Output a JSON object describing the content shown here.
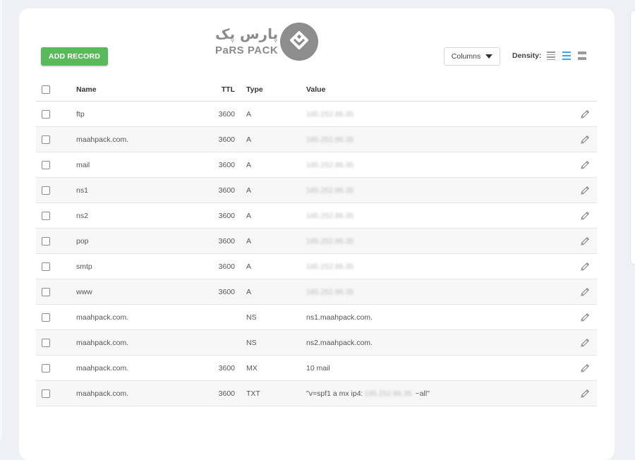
{
  "toolbar": {
    "add_record_label": "ADD RECORD",
    "columns_label": "Columns",
    "density_label": "Density:"
  },
  "logo": {
    "fa_text": "پارس پک",
    "en_text": "PaRS PACK"
  },
  "table": {
    "headers": {
      "name": "Name",
      "ttl": "TTL",
      "type": "Type",
      "value": "Value"
    },
    "rows": [
      {
        "name": "ftp",
        "ttl": "3600",
        "type": "A",
        "value": "185.252.86.35"
      },
      {
        "name": "maahpack.com.",
        "ttl": "3600",
        "type": "A",
        "value": "185.252.86.35"
      },
      {
        "name": "mail",
        "ttl": "3600",
        "type": "A",
        "value": "185.252.86.35"
      },
      {
        "name": "ns1",
        "ttl": "3600",
        "type": "A",
        "value": "185.252.86.35"
      },
      {
        "name": "ns2",
        "ttl": "3600",
        "type": "A",
        "value": "185.252.86.35"
      },
      {
        "name": "pop",
        "ttl": "3600",
        "type": "A",
        "value": "185.252.86.35"
      },
      {
        "name": "smtp",
        "ttl": "3600",
        "type": "A",
        "value": "185.252.86.35"
      },
      {
        "name": "www",
        "ttl": "3600",
        "type": "A",
        "value": "185.252.86.35"
      },
      {
        "name": "maahpack.com.",
        "ttl": "",
        "type": "NS",
        "value": "ns1.maahpack.com."
      },
      {
        "name": "maahpack.com.",
        "ttl": "",
        "type": "NS",
        "value": "ns2.maahpack.com."
      },
      {
        "name": "maahpack.com.",
        "ttl": "3600",
        "type": "MX",
        "value": "10 mail"
      },
      {
        "name": "maahpack.com.",
        "ttl": "3600",
        "type": "TXT",
        "value": "\"v=spf1 a mx ip4:",
        "value_hidden": "185.252.86.35",
        "value_suffix": " ~all\""
      }
    ]
  },
  "colors": {
    "accent_green": "#5cb85c",
    "density_active": "#3aa7e0"
  }
}
